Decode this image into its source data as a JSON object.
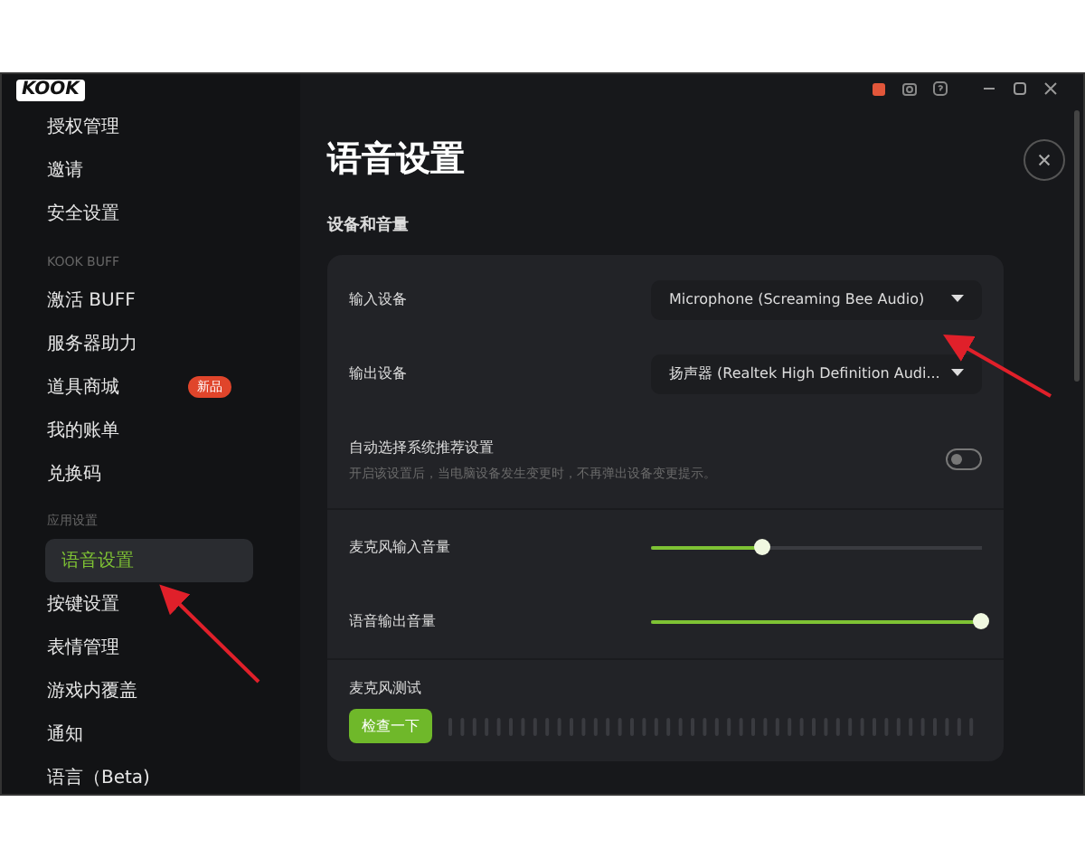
{
  "app": {
    "logo": "KOOK"
  },
  "sidebar": {
    "items": [
      {
        "kind": "item",
        "label": "授权管理",
        "selected": false
      },
      {
        "kind": "item",
        "label": "邀请",
        "selected": false
      },
      {
        "kind": "item",
        "label": "安全设置",
        "selected": false
      },
      {
        "kind": "header",
        "label": "KOOK BUFF"
      },
      {
        "kind": "item",
        "label": "激活 BUFF",
        "selected": false
      },
      {
        "kind": "item",
        "label": "服务器助力",
        "selected": false
      },
      {
        "kind": "item",
        "label": "道具商城",
        "selected": false,
        "badge": "新品"
      },
      {
        "kind": "item",
        "label": "我的账单",
        "selected": false
      },
      {
        "kind": "item",
        "label": "兑换码",
        "selected": false
      },
      {
        "kind": "header",
        "label": "应用设置"
      },
      {
        "kind": "item",
        "label": "语音设置",
        "selected": true
      },
      {
        "kind": "item",
        "label": "按键设置",
        "selected": false
      },
      {
        "kind": "item",
        "label": "表情管理",
        "selected": false
      },
      {
        "kind": "item",
        "label": "游戏内覆盖",
        "selected": false
      },
      {
        "kind": "item",
        "label": "通知",
        "selected": false
      },
      {
        "kind": "item",
        "label": "语言（Beta)",
        "selected": false
      }
    ]
  },
  "page": {
    "title": "语音设置",
    "section": "设备和音量",
    "rows": [
      {
        "kind": "select",
        "label": "输入设备",
        "value": "Microphone (Screaming Bee Audio)"
      },
      {
        "kind": "select",
        "label": "输出设备",
        "value": "扬声器 (Realtek High Definition Audi..."
      },
      {
        "kind": "toggle",
        "label": "自动选择系统推荐设置",
        "hint": "开启该设置后，当电脑设备发生变更时，不再弹出设备变更提示。",
        "on": false
      },
      {
        "kind": "slider",
        "label": "麦克风输入音量",
        "level": 0.34
      },
      {
        "kind": "slider",
        "label": "语音输出音量",
        "level": 1.0
      },
      {
        "kind": "test",
        "label": "麦克风测试",
        "button": "检查一下"
      }
    ]
  }
}
